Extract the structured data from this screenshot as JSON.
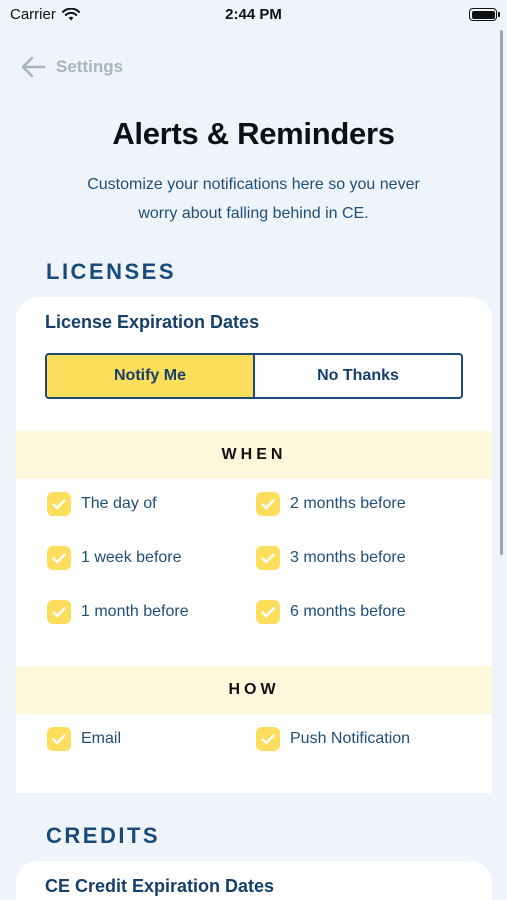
{
  "status_bar": {
    "carrier": "Carrier",
    "time": "2:44 PM"
  },
  "nav": {
    "back_label": "Settings"
  },
  "page": {
    "title": "Alerts & Reminders",
    "subtitle_line1": "Customize your notifications here so you never",
    "subtitle_line2": "worry about falling behind in CE."
  },
  "licenses": {
    "heading": "LICENSES",
    "card_title": "License Expiration Dates",
    "segmented": {
      "notify": "Notify Me",
      "no_thanks": "No Thanks",
      "selected": "Notify Me"
    },
    "when": {
      "label": "WHEN",
      "options": [
        {
          "label": "The day of",
          "checked": true
        },
        {
          "label": "2 months before",
          "checked": true
        },
        {
          "label": "1 week before",
          "checked": true
        },
        {
          "label": "3 months before",
          "checked": true
        },
        {
          "label": "1 month before",
          "checked": true
        },
        {
          "label": "6 months before",
          "checked": true
        }
      ]
    },
    "how": {
      "label": "HOW",
      "options": [
        {
          "label": "Email",
          "checked": true
        },
        {
          "label": "Push Notification",
          "checked": true
        }
      ]
    }
  },
  "credits": {
    "heading": "CREDITS",
    "card_title": "CE Credit Expiration Dates"
  },
  "colors": {
    "background": "#eef4f9",
    "accent_yellow": "#fddd5c",
    "band_yellow": "#fdf7dc",
    "navy": "#1a4a7a",
    "muted_gray": "#a9b4bd"
  },
  "icons": {
    "back": "arrow-left-icon",
    "wifi": "wifi-icon",
    "battery": "battery-icon",
    "checkbox": "checkmark-icon"
  }
}
